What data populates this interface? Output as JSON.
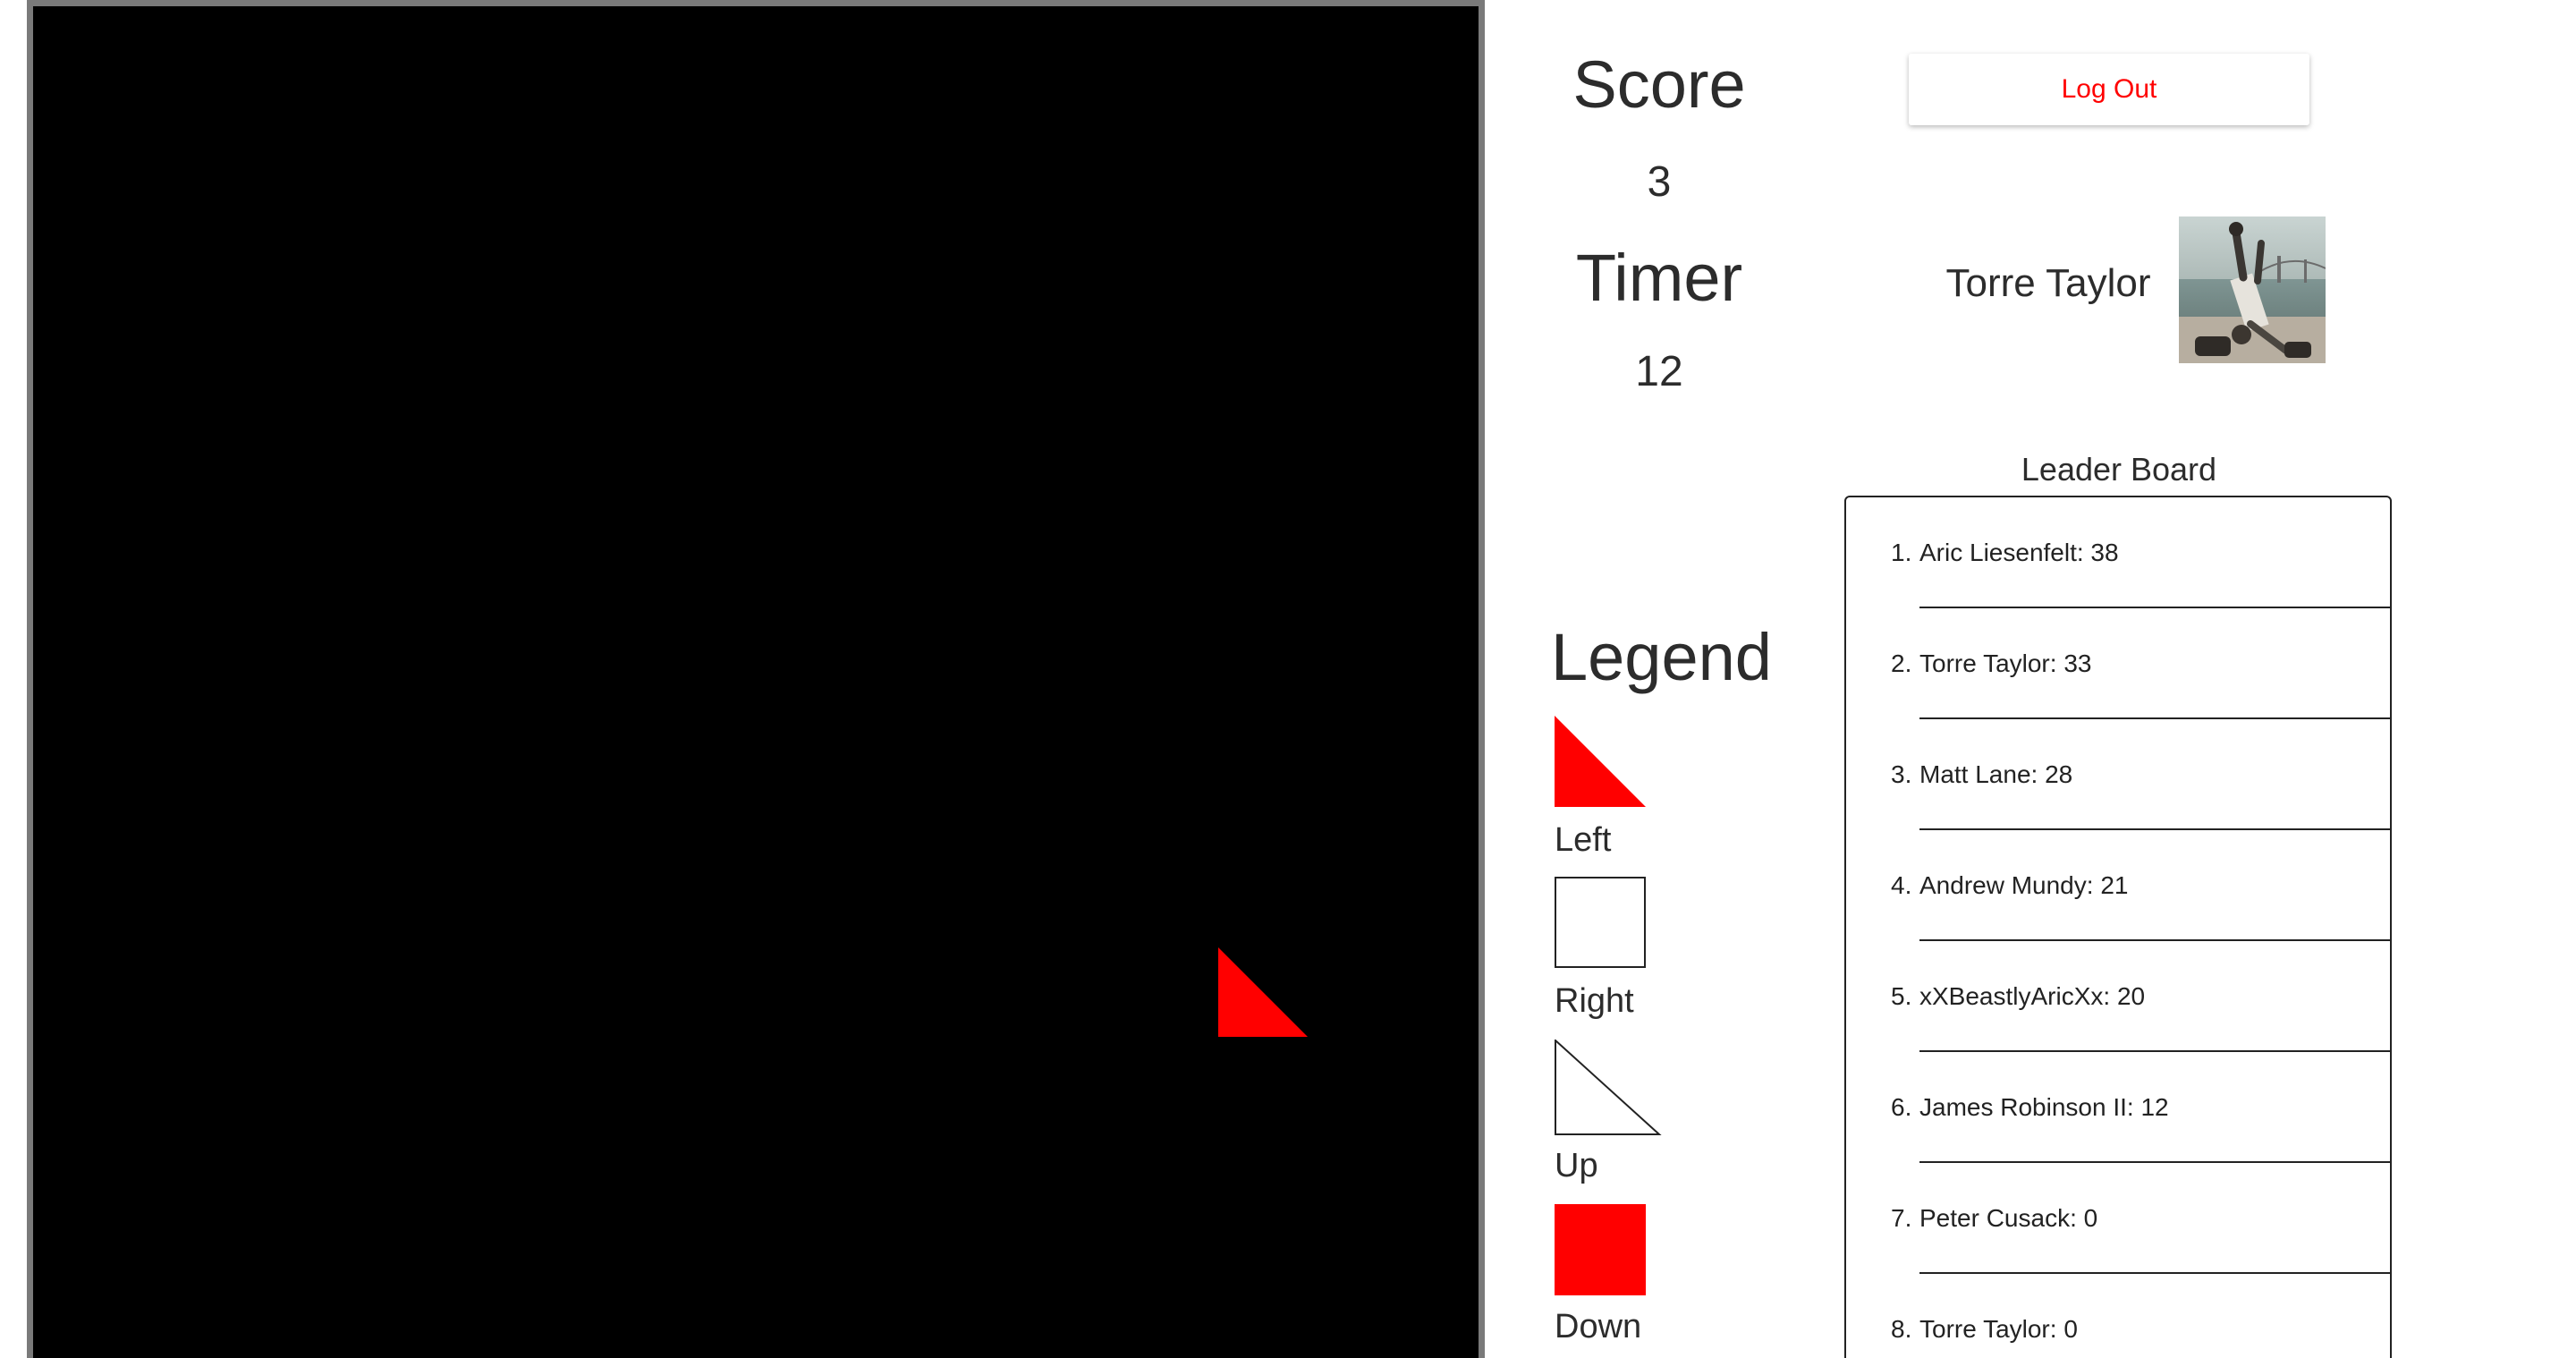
{
  "game": {
    "piece_color": "#ff0000",
    "board_color": "#000000"
  },
  "stats": {
    "score_label": "Score",
    "score_value": "3",
    "timer_label": "Timer",
    "timer_value": "12"
  },
  "auth": {
    "logout_label": "Log Out"
  },
  "user": {
    "name": "Torre Taylor"
  },
  "legend": {
    "title": "Legend",
    "items": [
      {
        "label": "Left",
        "shape": "red-triangle"
      },
      {
        "label": "Right",
        "shape": "white-square"
      },
      {
        "label": "Up",
        "shape": "white-triangle"
      },
      {
        "label": "Down",
        "shape": "red-square"
      }
    ]
  },
  "leaderboard": {
    "title": "Leader Board",
    "entries": [
      {
        "rank": "1.",
        "text": "Aric Liesenfelt: 38"
      },
      {
        "rank": "2.",
        "text": "Torre Taylor: 33"
      },
      {
        "rank": "3.",
        "text": "Matt Lane: 28"
      },
      {
        "rank": "4.",
        "text": "Andrew Mundy: 21"
      },
      {
        "rank": "5.",
        "text": "xXBeastlyAricXx: 20"
      },
      {
        "rank": "6.",
        "text": "James Robinson II: 12"
      },
      {
        "rank": "7.",
        "text": "Peter Cusack: 0"
      },
      {
        "rank": "8.",
        "text": "Torre Taylor: 0"
      }
    ]
  }
}
